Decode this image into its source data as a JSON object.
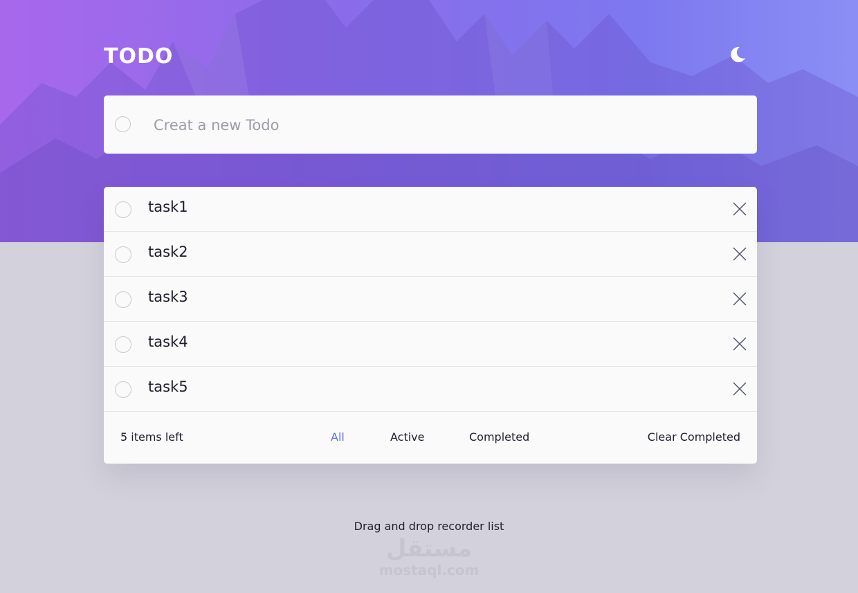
{
  "app": {
    "title": "TODO"
  },
  "theme_toggle": {
    "icon": "moon-icon"
  },
  "new_todo": {
    "placeholder": "Creat a new Todo",
    "value": ""
  },
  "tasks": [
    {
      "label": "task1",
      "completed": false
    },
    {
      "label": "task2",
      "completed": false
    },
    {
      "label": "task3",
      "completed": false
    },
    {
      "label": "task4",
      "completed": false
    },
    {
      "label": "task5",
      "completed": false
    }
  ],
  "footer": {
    "items_left": "5 items left",
    "filters": {
      "all": "All",
      "active": "Active",
      "completed": "Completed"
    },
    "selected_filter": "All",
    "clear_completed": "Clear Completed"
  },
  "hint": "Drag and drop recorder list",
  "watermark": {
    "arabic": "مستقل",
    "latin": "mostaql.com"
  },
  "colors": {
    "accent": "#5b6ee8",
    "hero_start": "#a868ec",
    "hero_end": "#8b8ff5",
    "page_bg": "#d3d2dc",
    "card_bg": "#fafafa"
  }
}
